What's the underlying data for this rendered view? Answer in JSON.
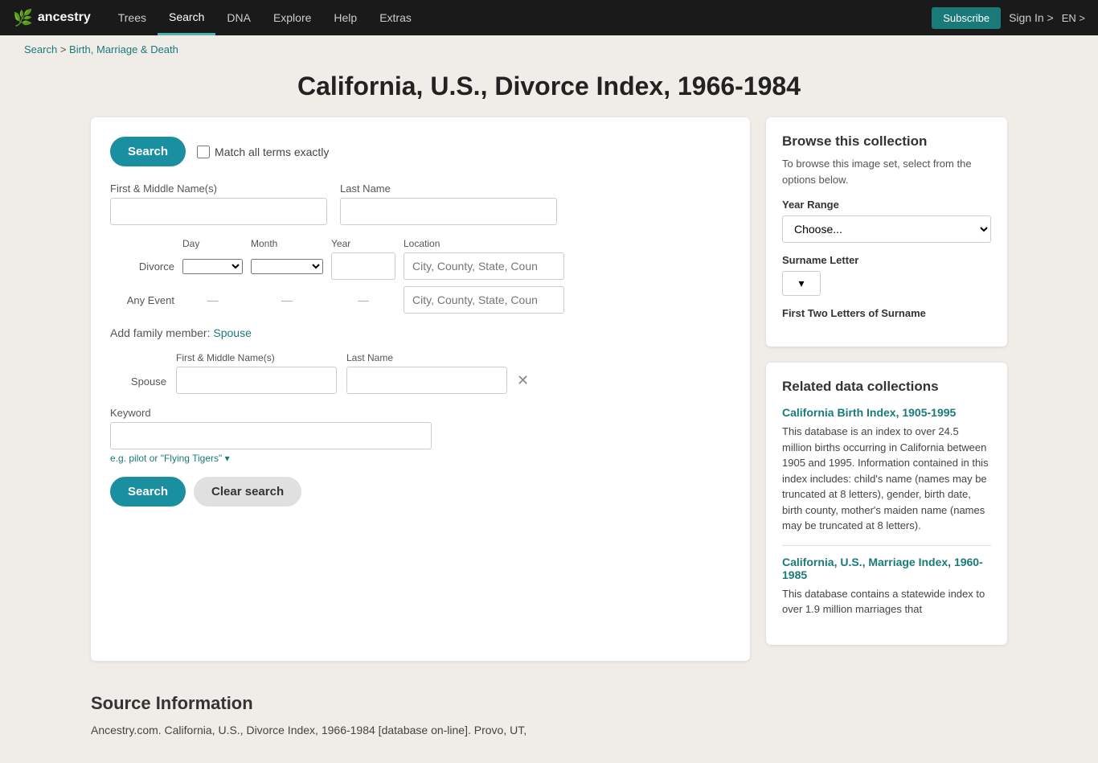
{
  "nav": {
    "logo_icon": "🌿",
    "logo_text": "ancestry",
    "links": [
      {
        "label": "Trees",
        "active": false
      },
      {
        "label": "Search",
        "active": true
      },
      {
        "label": "DNA",
        "active": false
      },
      {
        "label": "Explore",
        "active": false
      },
      {
        "label": "Help",
        "active": false
      },
      {
        "label": "Extras",
        "active": false
      }
    ],
    "subscribe_label": "Subscribe",
    "signin_label": "Sign In >",
    "lang_label": "EN >"
  },
  "breadcrumb": {
    "search_label": "Search",
    "separator": " > ",
    "section_label": "Birth, Marriage & Death"
  },
  "page_title": "California, U.S., Divorce Index, 1966-1984",
  "search_form": {
    "search_button": "Search",
    "match_exact_label": "Match all terms exactly",
    "first_name_label": "First & Middle Name(s)",
    "last_name_label": "Last Name",
    "divorce_label": "Divorce",
    "any_event_label": "Any Event",
    "day_label": "Day",
    "month_label": "Month",
    "year_label": "Year",
    "location_label": "Location",
    "location_placeholder": "City, County, State, Coun",
    "add_family_label": "Add family member:",
    "spouse_link": "Spouse",
    "spouse_label": "Spouse",
    "spouse_first_label": "First & Middle Name(s)",
    "spouse_last_label": "Last Name",
    "keyword_label": "Keyword",
    "keyword_hint": "e.g. pilot or \"Flying Tigers\" ▾",
    "clear_button": "Clear search",
    "dash": "—"
  },
  "browse": {
    "title": "Browse this collection",
    "desc": "To browse this image set, select from the options below.",
    "year_range_label": "Year Range",
    "year_range_placeholder": "Choose...",
    "surname_letter_label": "Surname Letter",
    "first_two_label": "First Two Letters of Surname"
  },
  "related": {
    "title": "Related data collections",
    "items": [
      {
        "link": "California Birth Index, 1905-1995",
        "desc": "This database is an index to over 24.5 million births occurring in California between 1905 and 1995. Information contained in this index includes: child's name (names may be truncated at 8 letters), gender, birth date, birth county, mother's maiden name (names may be truncated at 8 letters)."
      },
      {
        "link": "California, U.S., Marriage Index, 1960-1985",
        "desc": "This database contains a statewide index to over 1.9 million marriages that"
      }
    ]
  },
  "source": {
    "title": "Source Information",
    "text": "Ancestry.com. California, U.S., Divorce Index, 1966-1984 [database on-line]. Provo, UT,"
  }
}
